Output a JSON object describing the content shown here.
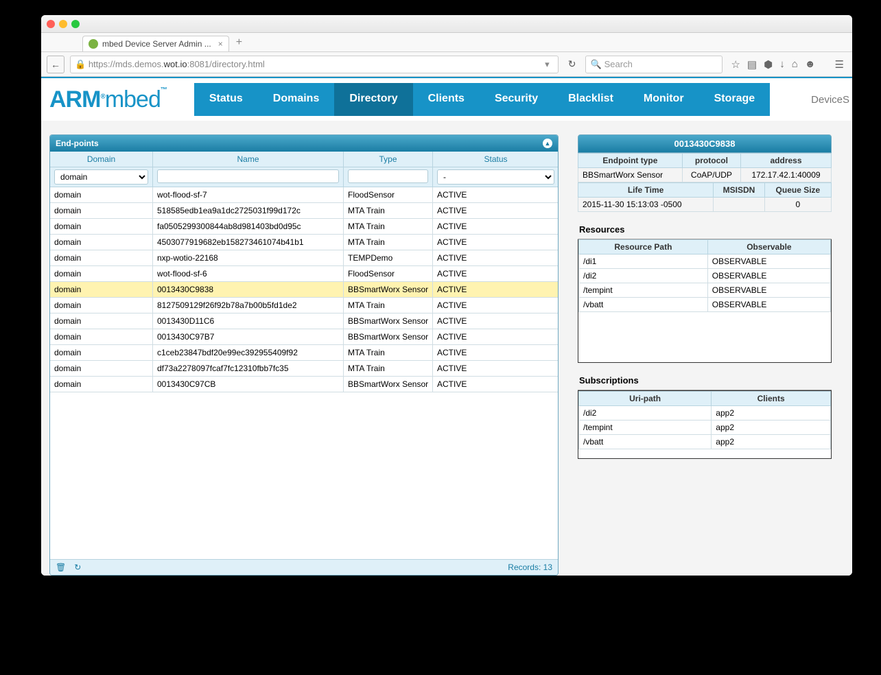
{
  "browser": {
    "tab_title": "mbed Device Server Admin ...",
    "url_prefix": "https://mds.demos.",
    "url_bold": "wot.io",
    "url_suffix": ":8081/directory.html",
    "search_placeholder": "Search"
  },
  "logo": {
    "arm": "ARM",
    "reg": "®",
    "mbed": "mbed",
    "tm": "™"
  },
  "nav": [
    "Status",
    "Domains",
    "Directory",
    "Clients",
    "Security",
    "Blacklist",
    "Monitor",
    "Storage"
  ],
  "nav_active_index": 2,
  "device_label": "DeviceS",
  "endpoints_panel": {
    "title": "End-points",
    "columns": [
      "Domain",
      "Name",
      "Type",
      "Status"
    ],
    "domain_filter_value": "domain",
    "status_filter_value": "-",
    "rows": [
      {
        "domain": "domain",
        "name": "wot-flood-sf-7",
        "type": "FloodSensor",
        "status": "ACTIVE"
      },
      {
        "domain": "domain",
        "name": "518585edb1ea9a1dc2725031f99d172c",
        "type": "MTA Train",
        "status": "ACTIVE"
      },
      {
        "domain": "domain",
        "name": "fa0505299300844ab8d981403bd0d95c",
        "type": "MTA Train",
        "status": "ACTIVE"
      },
      {
        "domain": "domain",
        "name": "4503077919682eb158273461074b41b1",
        "type": "MTA Train",
        "status": "ACTIVE"
      },
      {
        "domain": "domain",
        "name": "nxp-wotio-22168",
        "type": "TEMPDemo",
        "status": "ACTIVE"
      },
      {
        "domain": "domain",
        "name": "wot-flood-sf-6",
        "type": "FloodSensor",
        "status": "ACTIVE"
      },
      {
        "domain": "domain",
        "name": "0013430C9838",
        "type": "BBSmartWorx Sensor",
        "status": "ACTIVE",
        "highlight": true
      },
      {
        "domain": "domain",
        "name": "8127509129f26f92b78a7b00b5fd1de2",
        "type": "MTA Train",
        "status": "ACTIVE"
      },
      {
        "domain": "domain",
        "name": "0013430D11C6",
        "type": "BBSmartWorx Sensor",
        "status": "ACTIVE"
      },
      {
        "domain": "domain",
        "name": "0013430C97B7",
        "type": "BBSmartWorx Sensor",
        "status": "ACTIVE"
      },
      {
        "domain": "domain",
        "name": "c1ceb23847bdf20e99ec392955409f92",
        "type": "MTA Train",
        "status": "ACTIVE"
      },
      {
        "domain": "domain",
        "name": "df73a2278097fcaf7fc12310fbb7fc35",
        "type": "MTA Train",
        "status": "ACTIVE"
      },
      {
        "domain": "domain",
        "name": "0013430C97CB",
        "type": "BBSmartWorx Sensor",
        "status": "ACTIVE"
      }
    ],
    "records_label": "Records: 13"
  },
  "detail": {
    "id": "0013430C9838",
    "info_headers_1": [
      "Endpoint type",
      "protocol",
      "address"
    ],
    "info_values_1": [
      "BBSmartWorx Sensor",
      "CoAP/UDP",
      "172.17.42.1:40009"
    ],
    "info_headers_2": [
      "Life Time",
      "MSISDN",
      "Queue Size"
    ],
    "info_values_2": [
      "2015-11-30 15:13:03 -0500",
      "",
      "0"
    ],
    "resources_label": "Resources",
    "resources_headers": [
      "Resource Path",
      "Observable"
    ],
    "resources": [
      {
        "path": "/di1",
        "obs": "OBSERVABLE"
      },
      {
        "path": "/di2",
        "obs": "OBSERVABLE"
      },
      {
        "path": "/tempint",
        "obs": "OBSERVABLE"
      },
      {
        "path": "/vbatt",
        "obs": "OBSERVABLE"
      }
    ],
    "subscriptions_label": "Subscriptions",
    "subs_headers": [
      "Uri-path",
      "Clients"
    ],
    "subs": [
      {
        "uri": "/di2",
        "client": "app2"
      },
      {
        "uri": "/tempint",
        "client": "app2"
      },
      {
        "uri": "/vbatt",
        "client": "app2"
      }
    ]
  }
}
